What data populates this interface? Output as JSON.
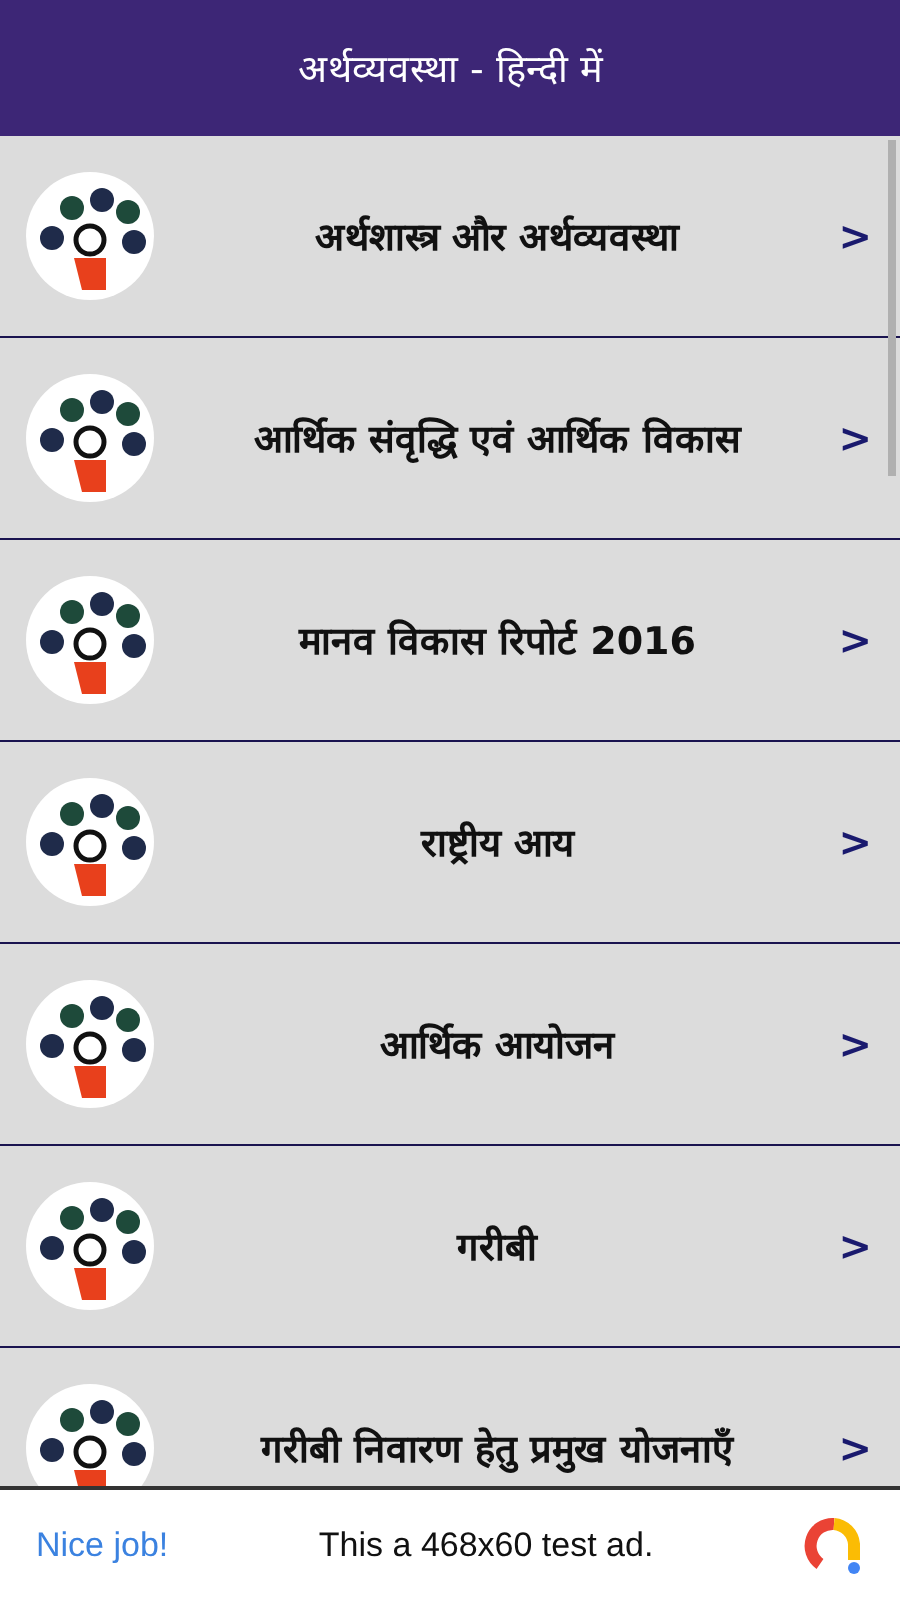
{
  "app_bar": {
    "title": "अर्थव्यवस्था - हिन्दी में"
  },
  "topics": [
    {
      "title": "अर्थशास्त्र और अर्थव्यवस्था",
      "chevron": ">"
    },
    {
      "title": "आर्थिक संवृद्धि एवं आर्थिक विकास",
      "chevron": ">"
    },
    {
      "title": "मानव विकास रिपोर्ट 2016",
      "chevron": ">"
    },
    {
      "title": "राष्ट्रीय आय",
      "chevron": ">"
    },
    {
      "title": "आर्थिक आयोजन",
      "chevron": ">"
    },
    {
      "title": "गरीबी",
      "chevron": ">"
    },
    {
      "title": "गरीबी निवारण हेतु प्रमुख योजनाएँ",
      "chevron": ">"
    }
  ],
  "ad_banner": {
    "headline": "Nice job!",
    "message": "This a 468x60 test ad."
  }
}
